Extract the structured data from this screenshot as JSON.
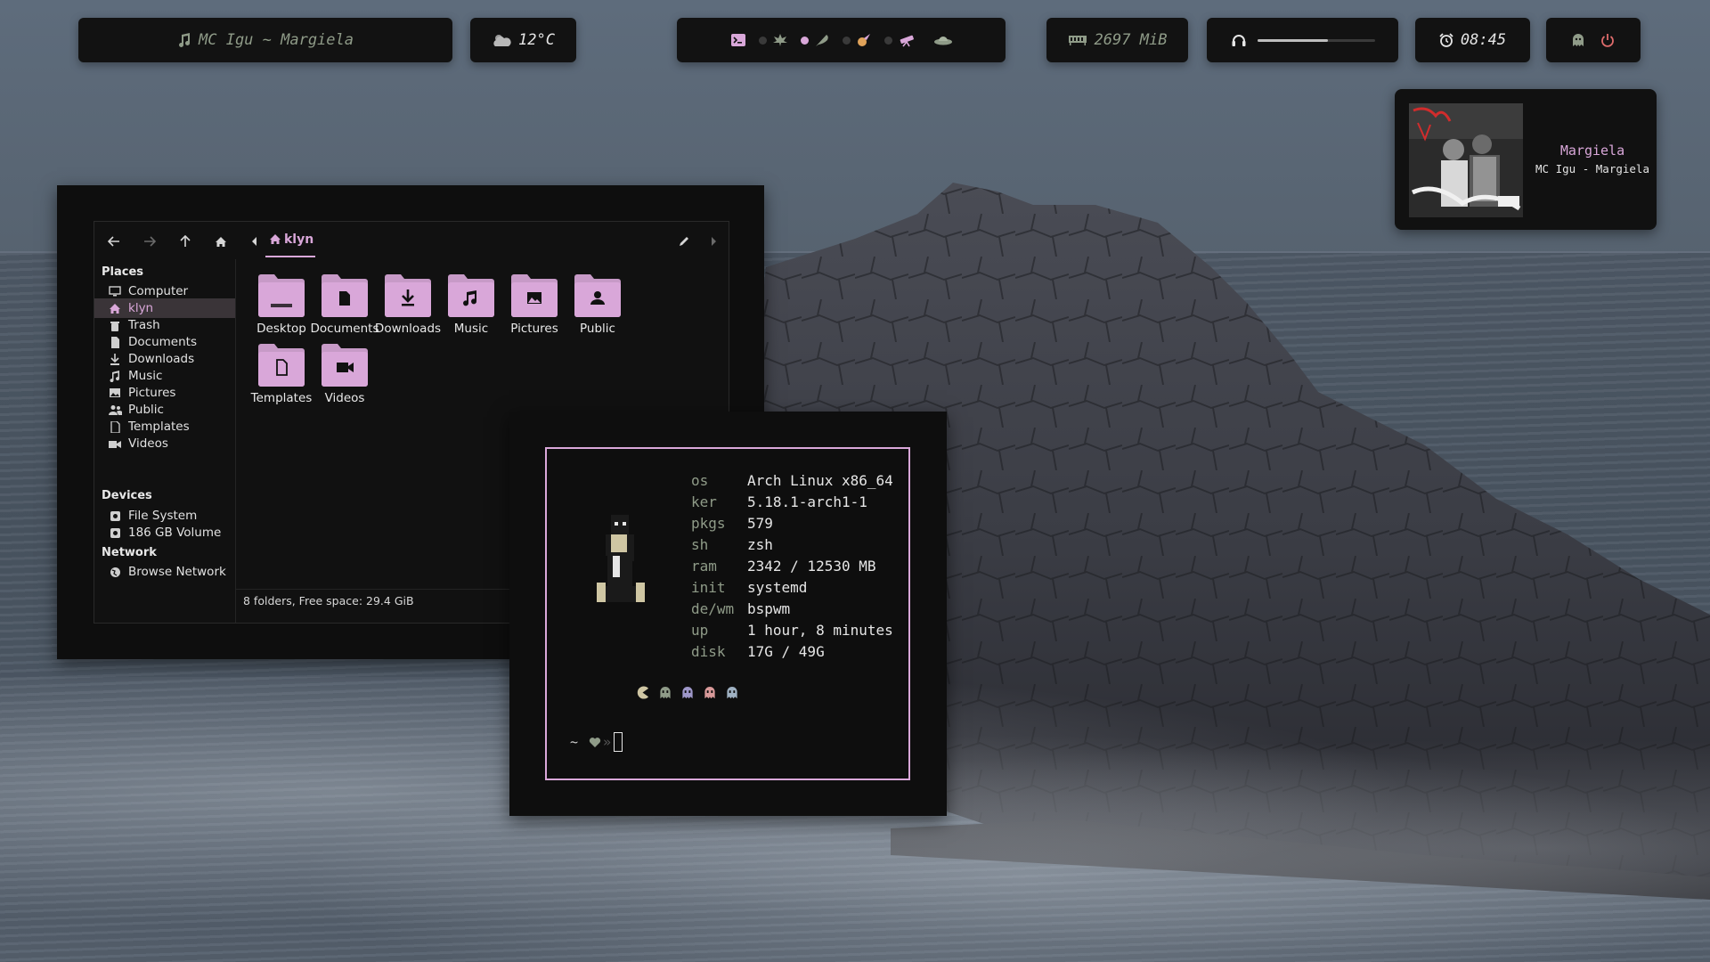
{
  "theme": {
    "accent": "#d9a7d9",
    "green": "#8f9b88",
    "panel": "#121212",
    "text": "#e6e6e6"
  },
  "topbar": {
    "music": {
      "icon": "music-note-icon",
      "text": "MC Igu ~ Margiela"
    },
    "weather": {
      "icon": "cloud-icon",
      "text": "12°C"
    },
    "workspaces": {
      "icons": [
        "terminal-icon",
        "leaf-icon",
        "feather-icon",
        "comet-icon",
        "telescope-icon",
        "ufo-icon"
      ]
    },
    "memory": {
      "icon": "memory-icon",
      "text": "2697 MiB"
    },
    "volume": {
      "icon": "headphones-icon",
      "level": 0.6
    },
    "clock": {
      "icon": "alarm-clock-icon",
      "text": "08:45"
    },
    "power": {
      "icons": [
        "ghost-icon",
        "power-icon"
      ]
    }
  },
  "music_card": {
    "title": "Margiela",
    "artist": "MC Igu - Margiela"
  },
  "file_manager": {
    "breadcrumb": "klyn",
    "sidebar": {
      "places_heading": "Places",
      "places": [
        {
          "label": "Computer",
          "icon": "monitor-icon"
        },
        {
          "label": "klyn",
          "icon": "home-icon",
          "selected": true
        },
        {
          "label": "Trash",
          "icon": "trash-icon"
        },
        {
          "label": "Documents",
          "icon": "document-icon"
        },
        {
          "label": "Downloads",
          "icon": "download-icon"
        },
        {
          "label": "Music",
          "icon": "music-icon"
        },
        {
          "label": "Pictures",
          "icon": "picture-icon"
        },
        {
          "label": "Public",
          "icon": "users-icon"
        },
        {
          "label": "Templates",
          "icon": "template-icon"
        },
        {
          "label": "Videos",
          "icon": "video-icon"
        }
      ],
      "devices_heading": "Devices",
      "devices": [
        {
          "label": "File System",
          "icon": "drive-icon"
        },
        {
          "label": "186 GB Volume",
          "icon": "drive-icon"
        }
      ],
      "network_heading": "Network",
      "network": [
        {
          "label": "Browse Network",
          "icon": "globe-icon"
        }
      ]
    },
    "folders": [
      "Desktop",
      "Documents",
      "Downloads",
      "Music",
      "Pictures",
      "Public",
      "Templates",
      "Videos"
    ],
    "status": "8 folders, Free space: 29.4 GiB"
  },
  "terminal": {
    "fetch": [
      {
        "key": "os",
        "value": "Arch Linux x86_64"
      },
      {
        "key": "ker",
        "value": "5.18.1-arch1-1"
      },
      {
        "key": "pkgs",
        "value": "579"
      },
      {
        "key": "sh",
        "value": "zsh"
      },
      {
        "key": "ram",
        "value": "2342 / 12530 MB"
      },
      {
        "key": "init",
        "value": "systemd"
      },
      {
        "key": "de/wm",
        "value": "bspwm"
      },
      {
        "key": "up",
        "value": "1 hour, 8 minutes"
      },
      {
        "key": "disk",
        "value": "17G / 49G"
      }
    ],
    "prompt_dir": "~",
    "prompt_arrow": "»"
  }
}
